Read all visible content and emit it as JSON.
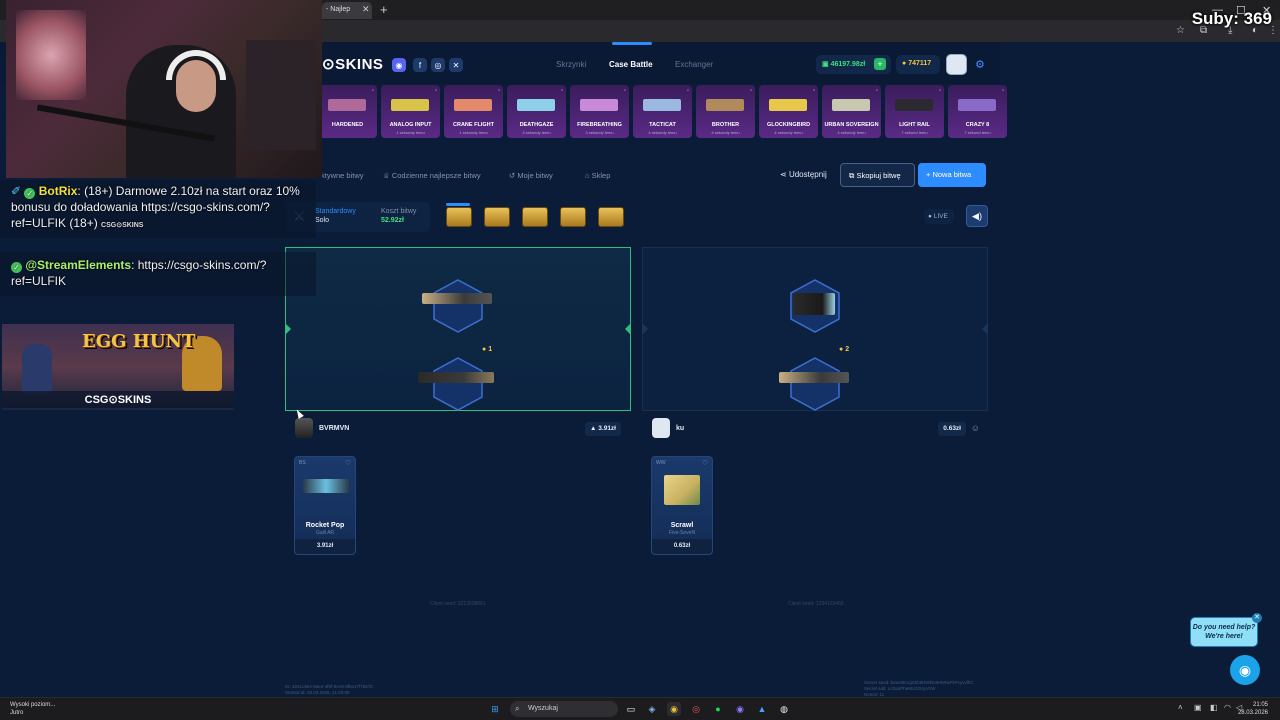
{
  "browser": {
    "tab_title": "- Najlep",
    "tab_close": "✕",
    "new_tab": "+",
    "min": "—",
    "max": "☐",
    "close": "✕"
  },
  "overlay": {
    "sub_counter": "Suby: 369"
  },
  "header": {
    "logo": "⊙SKINS",
    "nav": [
      "Skrzynki",
      "Case Battle",
      "Exchanger"
    ],
    "balance": "46197.98zł",
    "coins": "747117",
    "plus": "+"
  },
  "drops": [
    {
      "name": "HARDENED",
      "sub": "",
      "color": "#b06a9a"
    },
    {
      "name": "ANALOG INPUT",
      "sub": "1 sekundę temu",
      "color": "#d7c24a"
    },
    {
      "name": "CRANE FLIGHT",
      "sub": "1 sekundę temu",
      "color": "#e28a6a"
    },
    {
      "name": "DEATHGAZE",
      "sub": "3 sekundy temu",
      "color": "#8fd0e8"
    },
    {
      "name": "FIREBREATHING",
      "sub": "3 sekundy temu",
      "color": "#c88ad8"
    },
    {
      "name": "TACTICAT",
      "sub": "4 sekundy temu",
      "color": "#9ab8e0"
    },
    {
      "name": "BROTHER",
      "sub": "4 sekundy temu",
      "color": "#b08a5a"
    },
    {
      "name": "GLOCKINGBIRD",
      "sub": "4 sekundy temu",
      "color": "#e8c84a"
    },
    {
      "name": "URBAN SOVEREIGN",
      "sub": "4 sekundy temu",
      "color": "#c8c8b0"
    },
    {
      "name": "LIGHT RAIL",
      "sub": "7 sekund temu",
      "color": "#2a2a30"
    },
    {
      "name": "CRAZY 8",
      "sub": "7 sekund temu",
      "color": "#8a6ac8"
    }
  ],
  "toolbar": {
    "items": [
      "Aktywne bitwy",
      "Codzienne najlepsze bitwy",
      "Moje bitwy",
      "Sklep"
    ],
    "share": "Udostępnij",
    "copy": "Skopiuj bitwę",
    "new": "+ Nowa bitwa"
  },
  "battle": {
    "mode_label": "Standardowy",
    "mode_value": "Solo",
    "cost_label": "Koszt bitwy",
    "cost_value": "52.92zł",
    "live": "● LIVE",
    "round_left": "1",
    "round_right": "2"
  },
  "players": [
    {
      "name": "BVRMVN",
      "value": "▲ 3.91zł",
      "item": {
        "tag": "BS",
        "name": "Rocket Pop",
        "sub": "Galil AR",
        "price": "3.91zł"
      },
      "seed": "Client seed: 3213938861"
    },
    {
      "name": "ku",
      "value": "0.63zł",
      "item": {
        "tag": "WW",
        "name": "Scrawl",
        "sub": "Five-SeveN",
        "price": "0.63zł"
      },
      "seed": "Client seed: 1234123456"
    }
  ],
  "footer": {
    "id_line1": "ID: 4241c9e4-6ae4-4f5f-8e19-8fbe17f7b57b",
    "id_line2": "Started at: 28.03.2026, 21:03:00",
    "seed_line1": "Server seed: bees9Evq2dZ3EN5Ru9HMnkFkPcyvvlhC",
    "seed_line2": "Secret salt: LcSusPheMcGO4yVzW",
    "seed_line3": "Nonce: 11"
  },
  "help": {
    "text": "Do you need help? We're here!",
    "close": "✕"
  },
  "chat": [
    {
      "user": "BotRix",
      "text": ": (18+) Darmowe 2.10zł na start oraz 10% bonusu do doładowania https://csgo-skins.com/?ref=ULFIK (18+) ",
      "logo": "CSG⊙SKINS"
    },
    {
      "user": "@StreamElements",
      "text": ": https://csgo-skins.com/?ref=ULFIK"
    }
  ],
  "banner": {
    "title": "EGG HUNT",
    "logo": "CSG⊙SKINS"
  },
  "taskbar": {
    "notif_title": "Wysoki poziom...",
    "notif_sub": "Jutro",
    "search": "Wyszukaj",
    "time": "21:05",
    "date": "28.03.2026"
  }
}
